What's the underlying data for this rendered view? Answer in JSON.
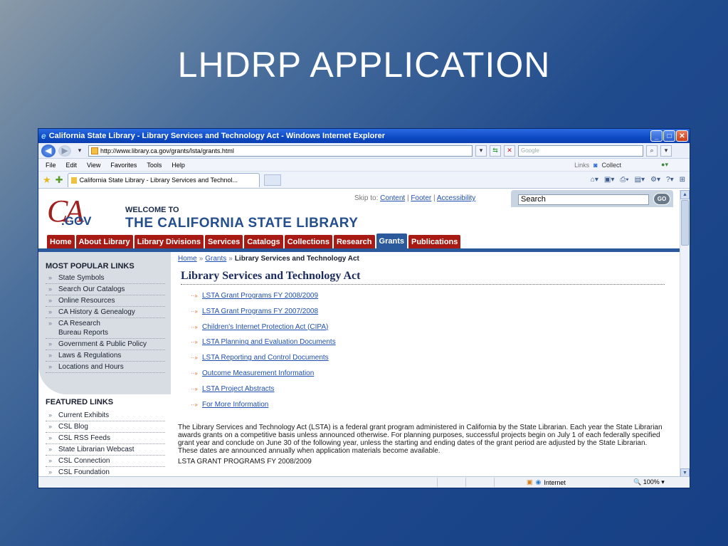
{
  "slide": {
    "title": "LHDRP APPLICATION"
  },
  "browser": {
    "window_title": "California State Library - Library Services and Technology Act - Windows Internet Explorer",
    "url": "http://www.library.ca.gov/grants/lsta/grants.html",
    "search_placeholder": "Google",
    "menu": [
      "File",
      "Edit",
      "View",
      "Favorites",
      "Tools",
      "Help"
    ],
    "links_label": "Links",
    "collect_label": "Collect",
    "tab_title": "California State Library - Library Services and Technol...",
    "status_zone": "Internet",
    "zoom": "100%"
  },
  "site": {
    "logo_ca": "CA",
    "logo_gov": ".GOV",
    "welcome": "WELCOME TO",
    "name": "THE CALIFORNIA STATE LIBRARY",
    "skip_to": "Skip to:",
    "skip_links": [
      "Content",
      "Footer",
      "Accessibility"
    ],
    "search_value": "Search",
    "go_label": "GO",
    "nav": [
      "Home",
      "About Library",
      "Library Divisions",
      "Services",
      "Catalogs",
      "Collections",
      "Research",
      "Grants",
      "Publications"
    ],
    "active_nav": "Grants"
  },
  "sidebar": {
    "popular_title": "MOST POPULAR LINKS",
    "popular": [
      "State Symbols",
      "Search Our Catalogs",
      "Online Resources",
      "CA History & Genealogy",
      "CA Research Bureau Reports",
      "Government & Public Policy",
      "Laws & Regulations",
      "Locations and Hours"
    ],
    "featured_title": "FEATURED LINKS",
    "featured": [
      "Current Exhibits",
      "CSL Blog",
      "CSL RSS Feeds",
      "State Librarian Webcast",
      "CSL Connection",
      "CSL Foundation"
    ]
  },
  "content": {
    "breadcrumb": [
      "Home",
      "Grants",
      "Library Services and Technology Act"
    ],
    "heading": "Library Services and Technology Act",
    "links": [
      "LSTA Grant Programs FY 2008/2009",
      "LSTA Grant Programs FY 2007/2008",
      "Children's Internet Protection Act (CIPA)",
      "LSTA Planning and Evaluation Documents",
      "LSTA Reporting and Control Documents",
      "Outcome Measurement Information",
      "LSTA Project Abstracts",
      "For More Information"
    ],
    "paragraph": "The Library Services and Technology Act (LSTA) is a federal grant program administered in California by the State Librarian. Each year the State Librarian awards grants on a competitive basis unless announced otherwise. For planning purposes, successful projects begin on July 1 of each federally specified grant year and conclude on June 30 of the following year, unless the starting and ending dates of the grant period are adjusted by the State Librarian. These dates are announced annually when application materials become available.",
    "next_heading": "LSTA GRANT PROGRAMS FY 2008/2009"
  }
}
